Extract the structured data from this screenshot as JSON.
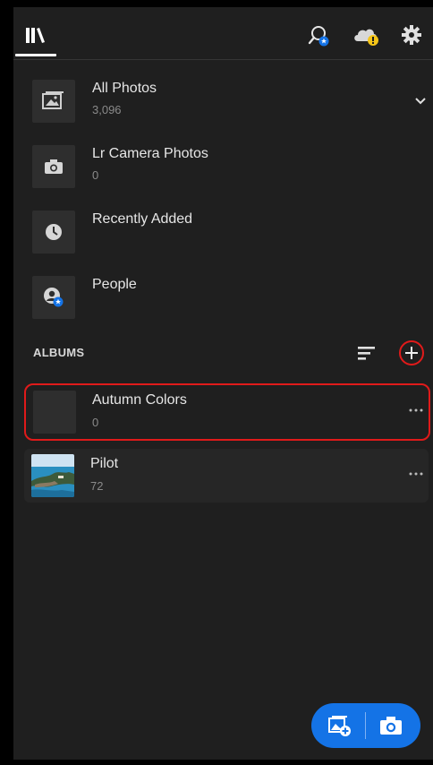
{
  "topbar": {
    "library_icon": "library-icon",
    "search_icon": "people-search-icon",
    "cloud_icon": "cloud-warning-icon",
    "settings_icon": "gear-icon",
    "warning_color": "#f5c518"
  },
  "sources": [
    {
      "title": "All Photos",
      "count": "3,096",
      "icon": "photo-icon"
    },
    {
      "title": "Lr Camera Photos",
      "count": "0",
      "icon": "camera-icon"
    },
    {
      "title": "Recently Added",
      "count": "",
      "icon": "clock-icon"
    },
    {
      "title": "People",
      "count": "",
      "icon": "people-icon"
    }
  ],
  "albums": {
    "header": "ALBUMS",
    "sort_icon": "sort-icon",
    "add_icon": "plus-icon",
    "items": [
      {
        "title": "Autumn Colors",
        "count": "0"
      },
      {
        "title": "Pilot",
        "count": "72"
      }
    ]
  },
  "fab": {
    "add_photos_icon": "add-photos-icon",
    "camera_icon": "camera-icon",
    "color": "#1473e6"
  },
  "highlight_color": "#e01a1a"
}
